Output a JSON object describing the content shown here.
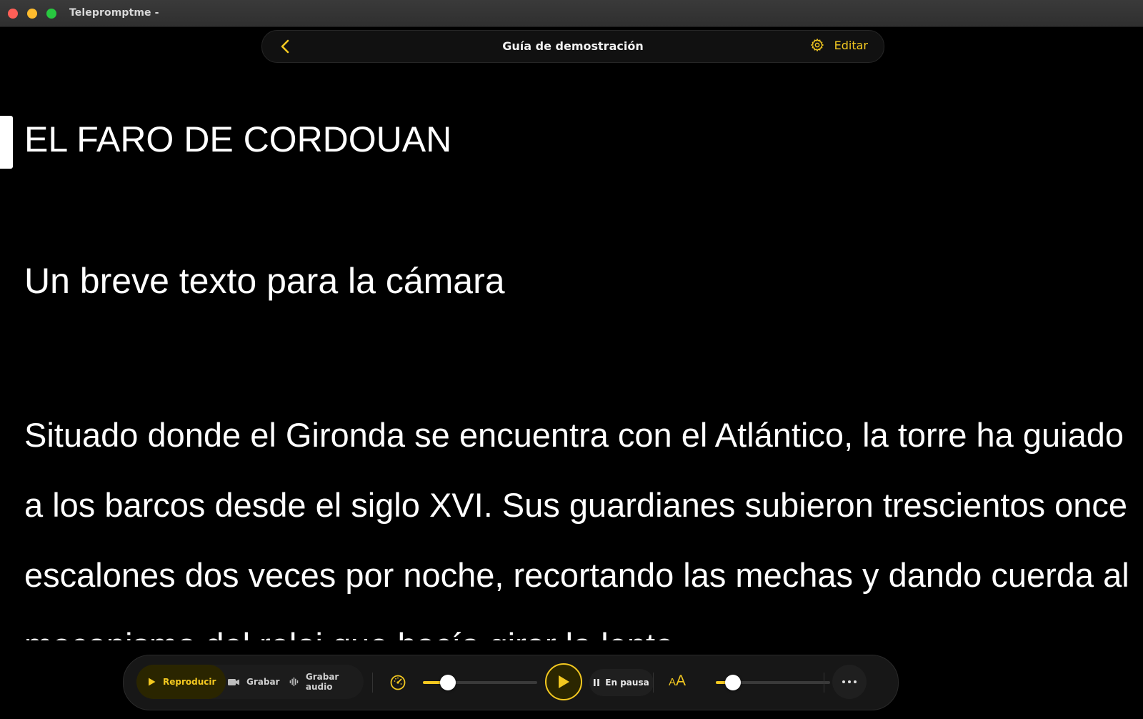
{
  "window": {
    "title": "Telepromptme -"
  },
  "header": {
    "title": "Guía de demostración",
    "edit_label": "Editar",
    "accent_color": "#f3c820"
  },
  "script": {
    "title": "EL FARO DE CORDOUAN",
    "subtitle": "Un breve texto para la cámara",
    "body": "Situado donde el Gironda se encuentra con el Atlántico, la torre ha guiado a los barcos desde el siglo XVI. Sus guardianes subieron trescientos once escalones dos veces por noche, recortando las mechas y dando cuerda al mecanismo del reloj que hacía girar la lente."
  },
  "toolbar": {
    "play_label": "Reproducir",
    "record_label": "Grabar",
    "record_audio_label": "Grabar audio",
    "status_label": "En pausa",
    "speed_level": 0.22,
    "font_size_level": 0.15,
    "icons": {
      "speed": "speedometer-icon",
      "font_size": "text-size-icon",
      "more": "ellipsis-icon"
    }
  }
}
